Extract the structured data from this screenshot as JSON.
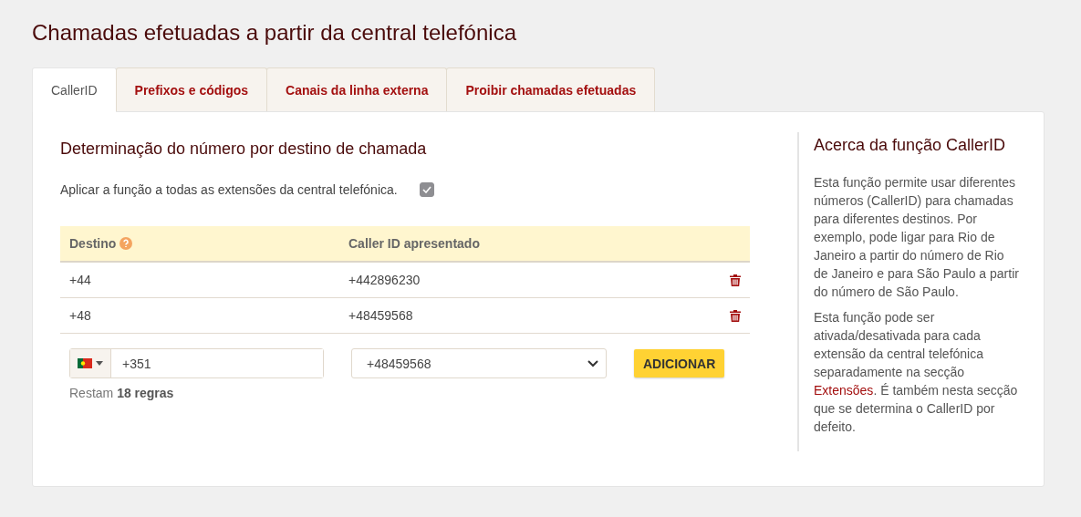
{
  "page": {
    "title": "Chamadas efetuadas a partir da central telefónica"
  },
  "tabs": [
    {
      "label": "CallerID",
      "selected": true
    },
    {
      "label": "Prefixos e códigos",
      "selected": false
    },
    {
      "label": "Canais da linha externa",
      "selected": false
    },
    {
      "label": "Proibir chamadas efetuadas",
      "selected": false
    }
  ],
  "main": {
    "heading": "Determinação do número por destino de chamada",
    "apply_all": {
      "label": "Aplicar a função a todas as extensões da central telefónica.",
      "checked": true
    },
    "table": {
      "columns": [
        "Destino",
        "Caller ID apresentado"
      ],
      "rows": [
        {
          "destination": "+44",
          "caller_id": "+442896230"
        },
        {
          "destination": "+48",
          "caller_id": "+48459568"
        }
      ]
    },
    "add_form": {
      "phone_value": "+351",
      "caller_id_value": "+48459568",
      "button": "ADICIONAR"
    },
    "remaining": "Restam **18 regras**"
  },
  "info": {
    "heading": "Acerca da função CallerID",
    "paragraphs": [
      {
        "text": "Esta função permite usar diferentes números (CallerID) para chamadas para diferentes destinos. Por exemplo, pode ligar para Rio de Janeiro a partir do número de Rio de Janeiro e para São Paulo a partir do número de São Paulo."
      },
      {
        "text": "Esta função pode ser ativada/desativada para cada extensão da central telefónica separadamente na secção ",
        "link": "Extensões",
        "after": ". É também nesta secção que se determina o CallerID por defeito."
      }
    ]
  }
}
